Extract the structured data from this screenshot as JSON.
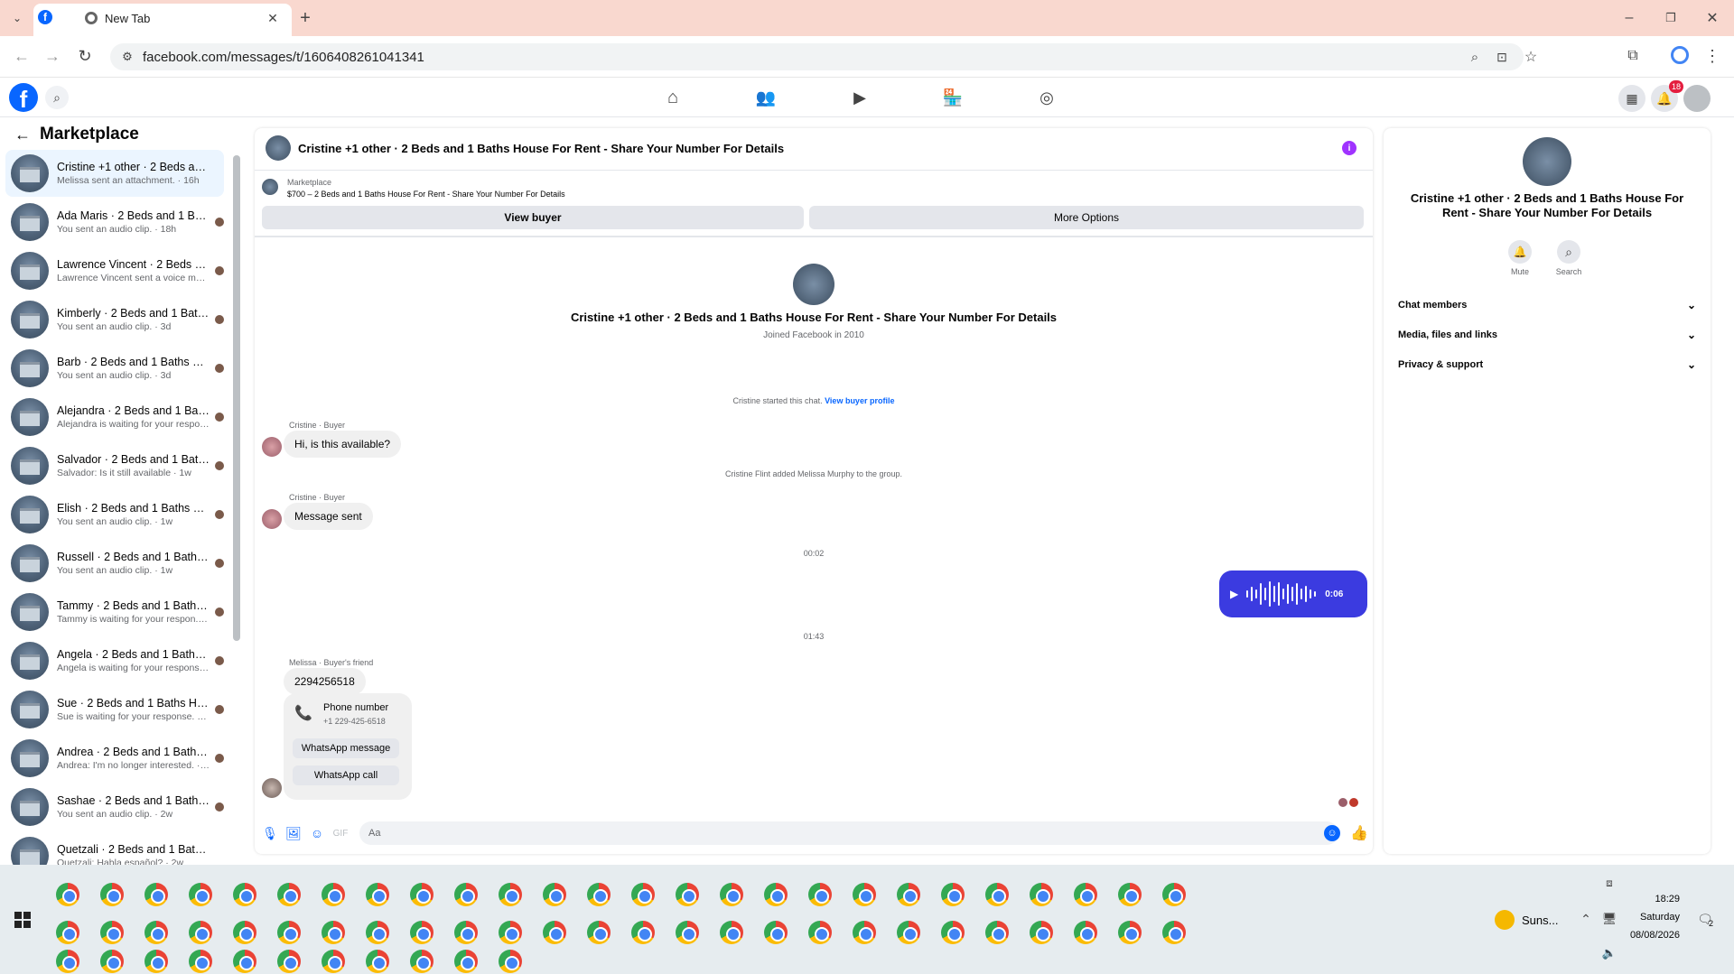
{
  "browser": {
    "tab_active_title": "",
    "tab2_title": "New Tab",
    "url": "facebook.com/messages/t/1606408261041341"
  },
  "header": {
    "notification_count": "18"
  },
  "sidebar": {
    "title": "Marketplace",
    "conversations": [
      {
        "name": "Cristine +1 other · 2 Beds and 1 ...",
        "snippet": "Melissa sent an attachment. · 16h"
      },
      {
        "name": "Ada Maris · 2 Beds and 1 Bat...",
        "snippet": "You sent an audio clip. · 18h"
      },
      {
        "name": "Lawrence Vincent · 2 Beds and ...",
        "snippet": "Lawrence Vincent sent a voice me... · 2d"
      },
      {
        "name": "Kimberly · 2 Beds and 1 Baths...",
        "snippet": "You sent an audio clip. · 3d"
      },
      {
        "name": "Barb · 2 Beds and 1 Baths Ho...",
        "snippet": "You sent an audio clip. · 3d"
      },
      {
        "name": "Alejandra · 2 Beds and 1 Baths ...",
        "snippet": "Alejandra is waiting for your respo... · 6d"
      },
      {
        "name": "Salvador · 2 Beds and 1 Baths H...",
        "snippet": "Salvador: Is it still available · 1w"
      },
      {
        "name": "Elish · 2 Beds and 1 Baths Ho...",
        "snippet": "You sent an audio clip. · 1w"
      },
      {
        "name": "Russell · 2 Beds and 1 Baths ...",
        "snippet": "You sent an audio clip. · 1w"
      },
      {
        "name": "Tammy · 2 Beds and 1 Baths Ho...",
        "snippet": "Tammy is waiting for your respon... · 1w"
      },
      {
        "name": "Angela · 2 Beds and 1 Baths Ho...",
        "snippet": "Angela is waiting for your response. · 1w"
      },
      {
        "name": "Sue · 2 Beds and 1 Baths House ...",
        "snippet": "Sue is waiting for your response. · 2w"
      },
      {
        "name": "Andrea · 2 Beds and 1 Baths Ho...",
        "snippet": "Andrea: I'm no longer interested. · 2w"
      },
      {
        "name": "Sashae · 2 Beds and 1 Baths ...",
        "snippet": "You sent an audio clip. · 2w"
      },
      {
        "name": "Quetzali · 2 Beds and 1 Baths H...",
        "snippet": "Quetzali: Habla español? · 2w"
      }
    ]
  },
  "chat": {
    "title": "Cristine +1 other · 2 Beds and 1 Baths House For Rent - Share Your Number For Details",
    "listing_label": "Marketplace",
    "listing_text": "$700 – 2 Beds and 1 Baths House For Rent - Share Your Number For Details",
    "view_buyer": "View buyer",
    "more_options": "More Options",
    "intro_title": "Cristine +1 other · 2 Beds and 1 Baths House For Rent - Share Your Number For Details",
    "intro_sub": "Joined Facebook in 2010",
    "started_text": "Cristine started this chat.",
    "view_buyer_profile": "View buyer profile",
    "sender1": "Cristine · Buyer",
    "msg1": "Hi, is this available?",
    "added_text": "Cristine Flint added Melissa Murphy to the group.",
    "sender2": "Cristine · Buyer",
    "msg2": "Message sent",
    "time1": "00:02",
    "audio_duration": "0:06",
    "time2": "01:43",
    "sender3": "Melissa · Buyer's friend",
    "msg3": "2294256518",
    "card_title": "Phone number",
    "card_number": "+1 229-425-6518",
    "whatsapp_message": "WhatsApp message",
    "whatsapp_call": "WhatsApp call",
    "composer_placeholder": "Aa"
  },
  "right_panel": {
    "title": "Cristine +1 other · 2 Beds and 1 Baths House For Rent - Share Your Number For Details",
    "mute": "Mute",
    "search": "Search",
    "sections": [
      "Chat members",
      "Media, files and links",
      "Privacy & support"
    ]
  },
  "taskbar": {
    "weather": "Suns...",
    "time": "18:29",
    "day": "Saturday",
    "date": "08/08/2026",
    "notif_count": "2"
  },
  "colors": {
    "accent": "#0866ff",
    "audio_bubble": "#3b3be0",
    "tab_bar": "#f9d8cf"
  }
}
